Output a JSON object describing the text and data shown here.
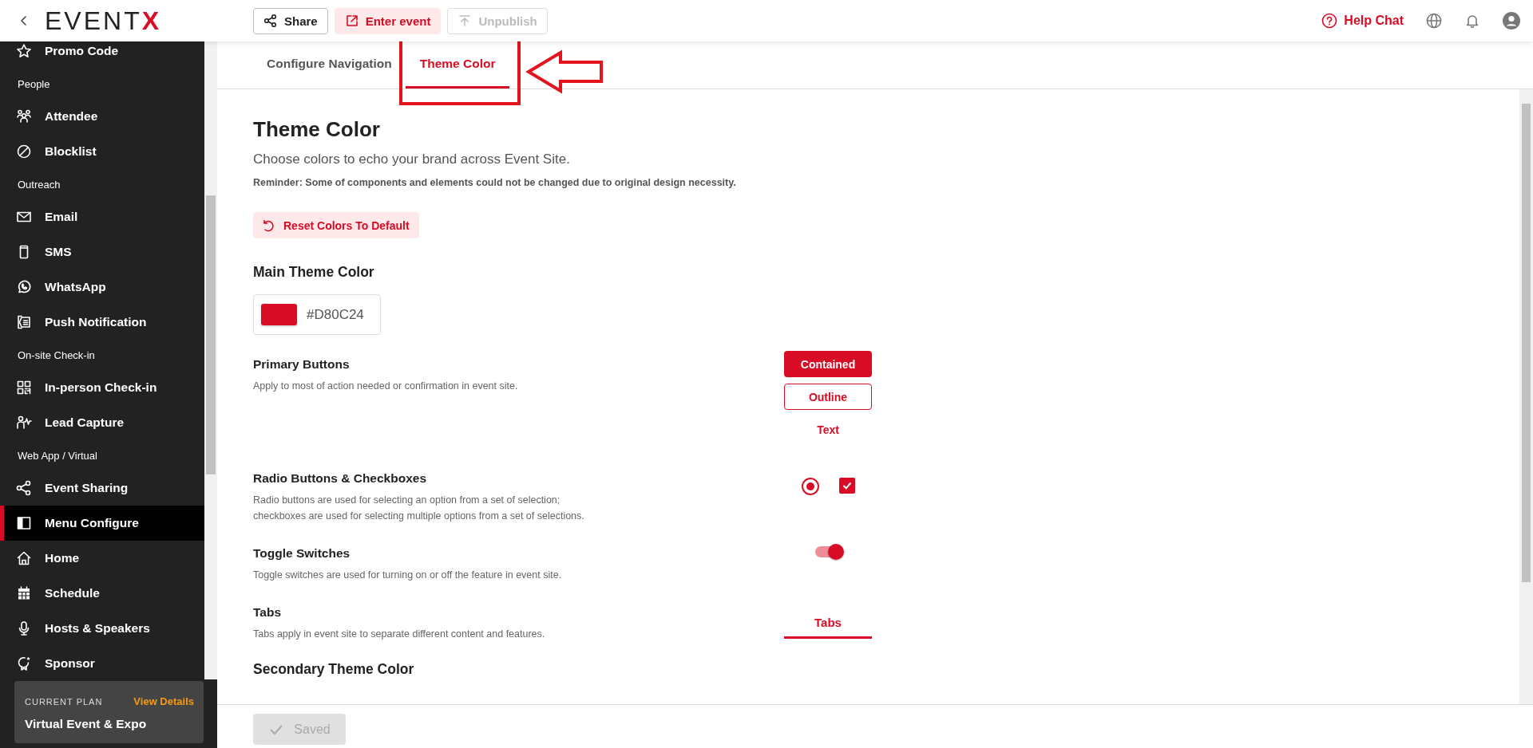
{
  "header": {
    "logo": [
      "EVEN",
      "T",
      "X"
    ],
    "actions": [
      {
        "label": "Share",
        "kind": "outline",
        "disabled": false
      },
      {
        "label": "Enter event",
        "kind": "tinted",
        "disabled": false
      },
      {
        "label": "Unpublish",
        "kind": "outline",
        "disabled": true
      }
    ],
    "help": "Help Chat"
  },
  "sidebar": {
    "items": [
      {
        "kind": "item",
        "label": "Promo Code",
        "selected": false
      },
      {
        "kind": "group",
        "label": "People"
      },
      {
        "kind": "item",
        "label": "Attendee",
        "selected": false
      },
      {
        "kind": "item",
        "label": "Blocklist",
        "selected": false
      },
      {
        "kind": "group",
        "label": "Outreach"
      },
      {
        "kind": "item",
        "label": "Email",
        "selected": false
      },
      {
        "kind": "item",
        "label": "SMS",
        "selected": false
      },
      {
        "kind": "item",
        "label": "WhatsApp",
        "selected": false
      },
      {
        "kind": "item",
        "label": "Push Notification",
        "selected": false
      },
      {
        "kind": "group",
        "label": "On-site Check-in"
      },
      {
        "kind": "item",
        "label": "In-person Check-in",
        "selected": false
      },
      {
        "kind": "item",
        "label": "Lead Capture",
        "selected": false
      },
      {
        "kind": "group",
        "label": "Web App / Virtual"
      },
      {
        "kind": "item",
        "label": "Event Sharing",
        "selected": false
      },
      {
        "kind": "item",
        "label": "Menu Configure",
        "selected": true
      },
      {
        "kind": "item",
        "label": "Home",
        "selected": false
      },
      {
        "kind": "item",
        "label": "Schedule",
        "selected": false
      },
      {
        "kind": "item",
        "label": "Hosts & Speakers",
        "selected": false
      },
      {
        "kind": "item",
        "label": "Sponsor",
        "selected": false
      }
    ],
    "plan": {
      "label": "CURRENT PLAN",
      "link": "View Details",
      "name": "Virtual Event & Expo"
    }
  },
  "tabs": [
    {
      "label": "Configure Navigation",
      "selected": false
    },
    {
      "label": "Theme Color",
      "selected": true
    }
  ],
  "annotation": {
    "kind": "box-arrow"
  },
  "page": {
    "title": "Theme Color",
    "subtitle": "Choose colors to echo your brand across Event Site.",
    "reminder": "Reminder: Some of components and elements could not be changed due to original design necessity.",
    "reset_button": "Reset Colors To Default",
    "main_heading": "Main Theme Color",
    "main_color": {
      "color": "#d80c24",
      "value": "#D80C24"
    },
    "sections": [
      {
        "kind": "buttons",
        "title": "Primary Buttons",
        "description": "Apply to most of action needed or confirmation in event site.",
        "buttons": [
          {
            "label": "Contained",
            "kind": "contained"
          },
          {
            "label": "Outline",
            "kind": "outline"
          },
          {
            "label": "Text",
            "kind": "text"
          }
        ]
      },
      {
        "kind": "controls",
        "title": "Radio Buttons & Checkboxes",
        "description": "Radio buttons are used for selecting an option from a set of selection;\ncheckboxes are used for selecting multiple options from a set of selections.",
        "radio_selected": true,
        "checkbox_checked": true
      },
      {
        "kind": "toggle",
        "title": "Toggle Switches",
        "description": "Toggle switches are used for turning on or off the feature in event site.",
        "on": true
      },
      {
        "kind": "tabs",
        "title": "Tabs",
        "description": "Tabs apply in event site to separate different content and features.",
        "tab": {
          "label": "Tabs",
          "selected": true
        }
      }
    ],
    "secondary_heading": "Secondary Theme Color"
  },
  "footer": {
    "save": {
      "label": "Saved",
      "disabled": true
    }
  }
}
